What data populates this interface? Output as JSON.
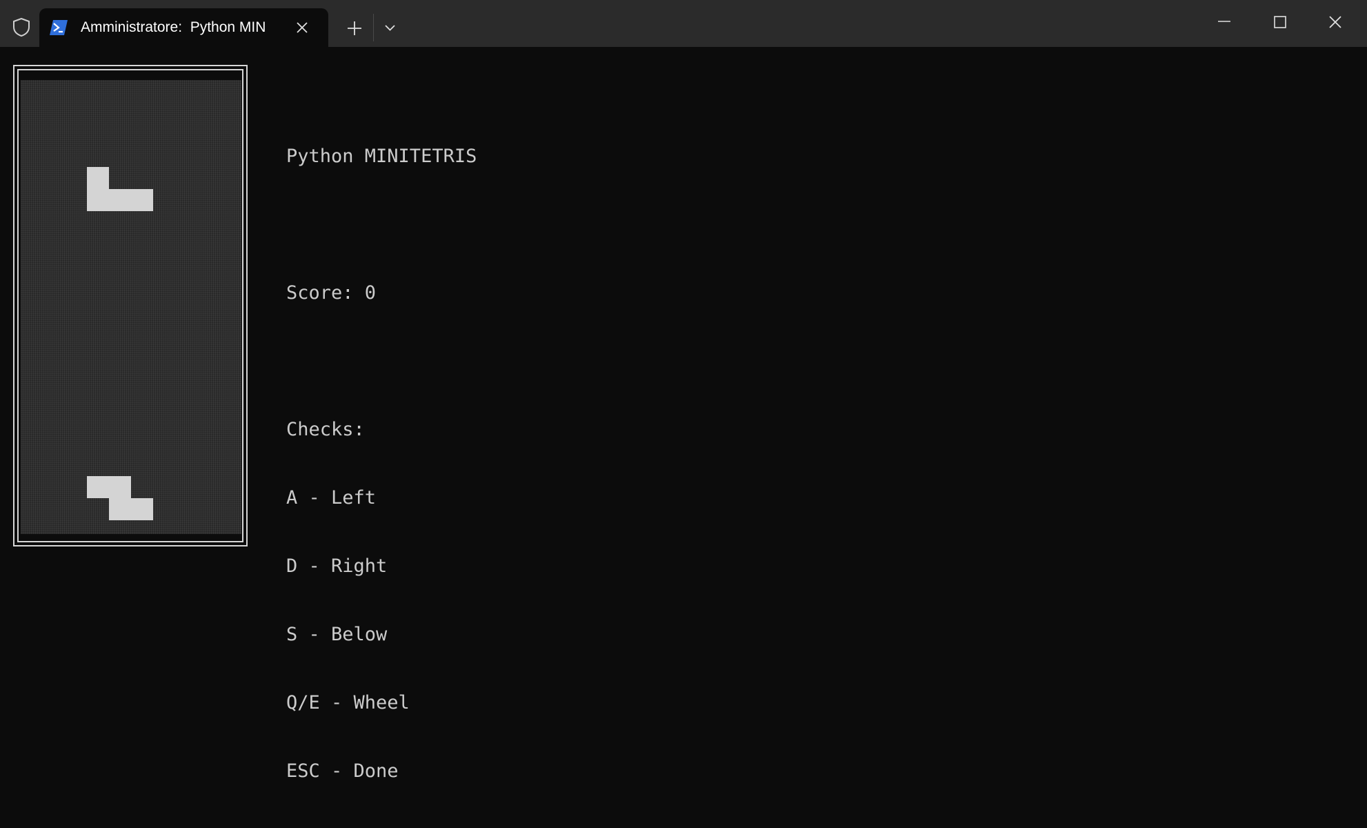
{
  "window": {
    "tab_title": "Amministratore:  Python MIN",
    "icons": {
      "shield": "shield-icon",
      "tab": "powershell-icon",
      "close_tab": "close-icon",
      "new_tab": "plus-icon",
      "dropdown": "chevron-down-icon",
      "minimize": "minimize-icon",
      "maximize": "maximize-icon",
      "close_window": "close-icon"
    }
  },
  "game": {
    "title": "Python MINITETRIS",
    "score_label": "Score: 0",
    "checks_header": "Checks:",
    "controls": [
      "A - Left",
      "D - Right",
      "S - Below",
      "Q/E - Wheel",
      "ESC - Done"
    ],
    "pieces": [
      {
        "name": "falling-piece",
        "shape": "L",
        "cells": [
          [
            3,
            4
          ],
          [
            3,
            5
          ],
          [
            4,
            5
          ],
          [
            5,
            5
          ]
        ]
      },
      {
        "name": "landed-piece",
        "shape": "Z",
        "cells": [
          [
            3,
            18
          ],
          [
            4,
            18
          ],
          [
            4,
            19
          ],
          [
            5,
            19
          ]
        ]
      }
    ],
    "colors": {
      "block": "#d4d4d4",
      "field": "#2e2e2e",
      "border": "#d6d6d6",
      "text": "#cccccc"
    }
  }
}
